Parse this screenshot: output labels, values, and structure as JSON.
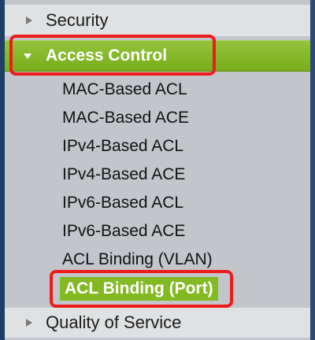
{
  "sidebar": {
    "top_item": {
      "label": "Security",
      "icon": "triangle-right-icon"
    },
    "section": {
      "label": "Access Control",
      "icon": "triangle-down-icon",
      "color": "#83b923"
    },
    "sub_items": [
      {
        "label": "MAC-Based ACL"
      },
      {
        "label": "MAC-Based ACE"
      },
      {
        "label": "IPv4-Based ACL"
      },
      {
        "label": "IPv4-Based ACE"
      },
      {
        "label": "IPv6-Based ACL"
      },
      {
        "label": "IPv6-Based ACE"
      },
      {
        "label": "ACL Binding (VLAN)"
      },
      {
        "label": "ACL Binding (Port)",
        "selected": true
      }
    ],
    "bottom_item": {
      "label": "Quality of Service",
      "icon": "triangle-right-icon"
    }
  },
  "annotations": {
    "highlight_color": "#ee1b1b"
  }
}
